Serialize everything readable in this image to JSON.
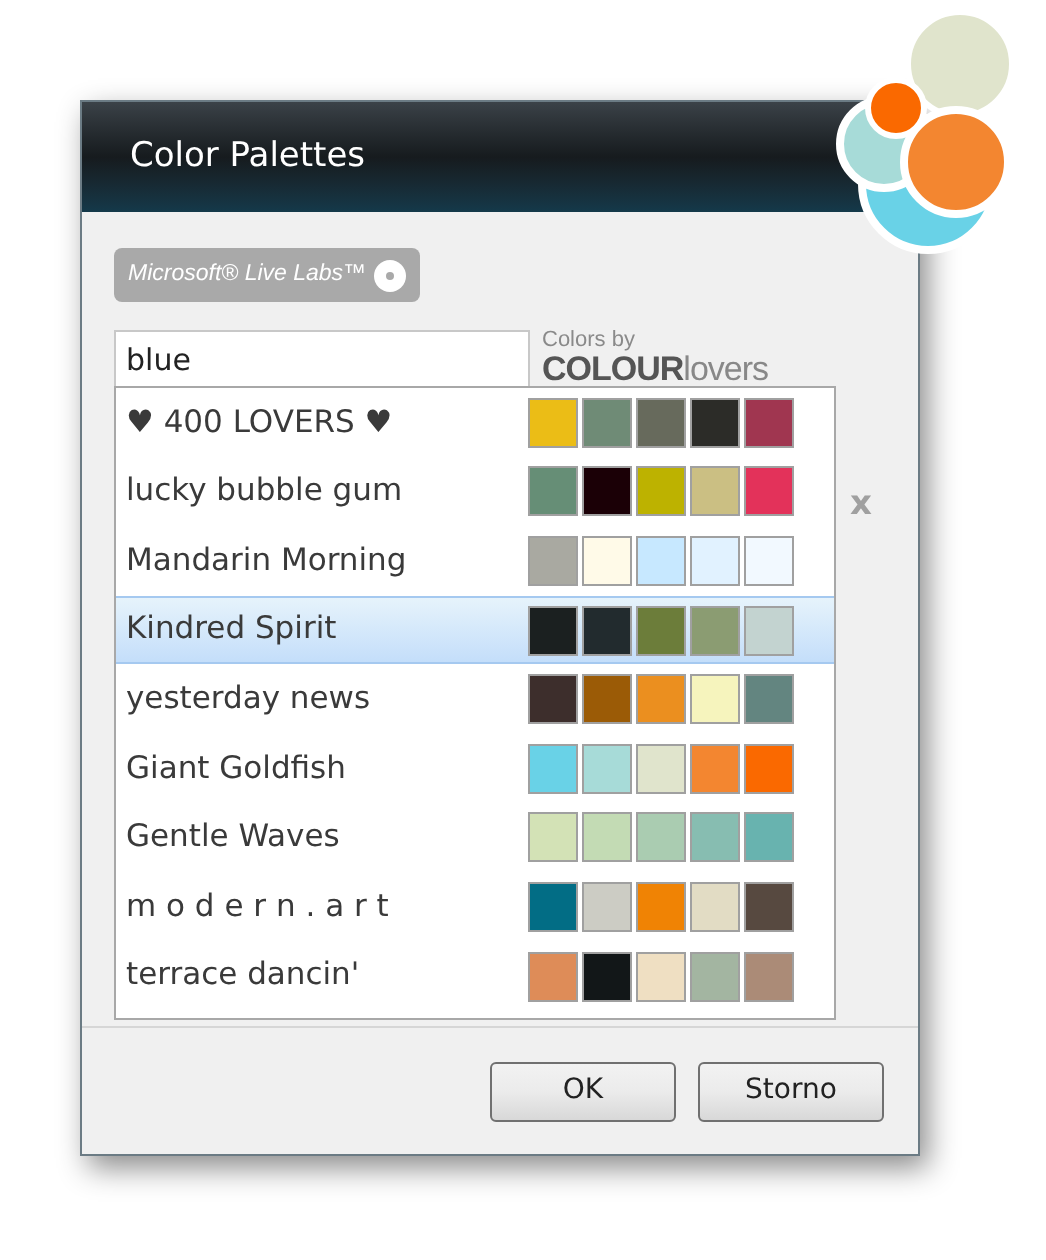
{
  "window": {
    "title": "Color Palettes"
  },
  "badge": {
    "label": "Microsoft® Live Labs™"
  },
  "search": {
    "value": "blue"
  },
  "credit": {
    "caption": "Colors by",
    "brand_bold": "COLOUR",
    "brand_light": "lovers"
  },
  "palettes": [
    {
      "name": "♥ 400 LOVERS ♥",
      "selected": false,
      "swatches": [
        {
          "color": "#ebbd16"
        },
        {
          "color": "#6f8b76"
        },
        {
          "color": "#676a5c"
        },
        {
          "color": "#2c2c28"
        },
        {
          "color": "#a03650"
        }
      ]
    },
    {
      "name": "lucky bubble gum",
      "selected": false,
      "swatches": [
        {
          "color": "#668e76"
        },
        {
          "color": "#1b0006"
        },
        {
          "color": "#bdb200"
        },
        {
          "color": "#cbbf83"
        },
        {
          "color": "#e3325a"
        }
      ]
    },
    {
      "name": "Mandarin Morning",
      "selected": false,
      "swatches": [
        {
          "color": "#a9a9a1"
        },
        {
          "color": "#fffae8"
        },
        {
          "color": "#c7e8ff"
        },
        {
          "color": "#e1f2ff"
        },
        {
          "color": "#f2f9ff"
        }
      ]
    },
    {
      "name": "Kindred Spirit",
      "selected": true,
      "swatches": [
        {
          "color": "#1b2020"
        },
        {
          "color": "#222b2e"
        },
        {
          "color": "#6c7d3a"
        },
        {
          "color": "#8b9c72"
        },
        {
          "color": "#c3d3d0"
        }
      ]
    },
    {
      "name": "yesterday news",
      "selected": false,
      "swatches": [
        {
          "color": "#3d2e2c"
        },
        {
          "color": "#9b5b06"
        },
        {
          "color": "#eb8f1f"
        },
        {
          "color": "#f6f4bd"
        },
        {
          "color": "#638580"
        }
      ]
    },
    {
      "name": "Giant Goldfish",
      "selected": false,
      "swatches": [
        {
          "color": "#69d2e7"
        },
        {
          "color": "#a7dbd8"
        },
        {
          "color": "#e0e4cc"
        },
        {
          "color": "#f38630"
        },
        {
          "color": "#fa6900"
        }
      ]
    },
    {
      "name": "Gentle Waves",
      "selected": false,
      "swatches": [
        {
          "color": "#d3e2b6"
        },
        {
          "color": "#c3dbb4"
        },
        {
          "color": "#aaccb1"
        },
        {
          "color": "#87bdb1"
        },
        {
          "color": "#68b3af"
        }
      ]
    },
    {
      "name": "m o d e r n . a r t",
      "selected": false,
      "swatches": [
        {
          "color": "#026d85"
        },
        {
          "color": "#ccccc4"
        },
        {
          "color": "#f08304"
        },
        {
          "color": "#e2dcc4"
        },
        {
          "color": "#574940"
        }
      ]
    },
    {
      "name": "terrace dancin'",
      "selected": false,
      "swatches": [
        {
          "color": "#de8c58"
        },
        {
          "color": "#121718"
        },
        {
          "color": "#efdfc2"
        },
        {
          "color": "#a3b5a1"
        },
        {
          "color": "#ab8b77"
        }
      ]
    }
  ],
  "close_mark": "x",
  "buttons": [
    {
      "label": "OK"
    },
    {
      "label": "Storno"
    }
  ]
}
